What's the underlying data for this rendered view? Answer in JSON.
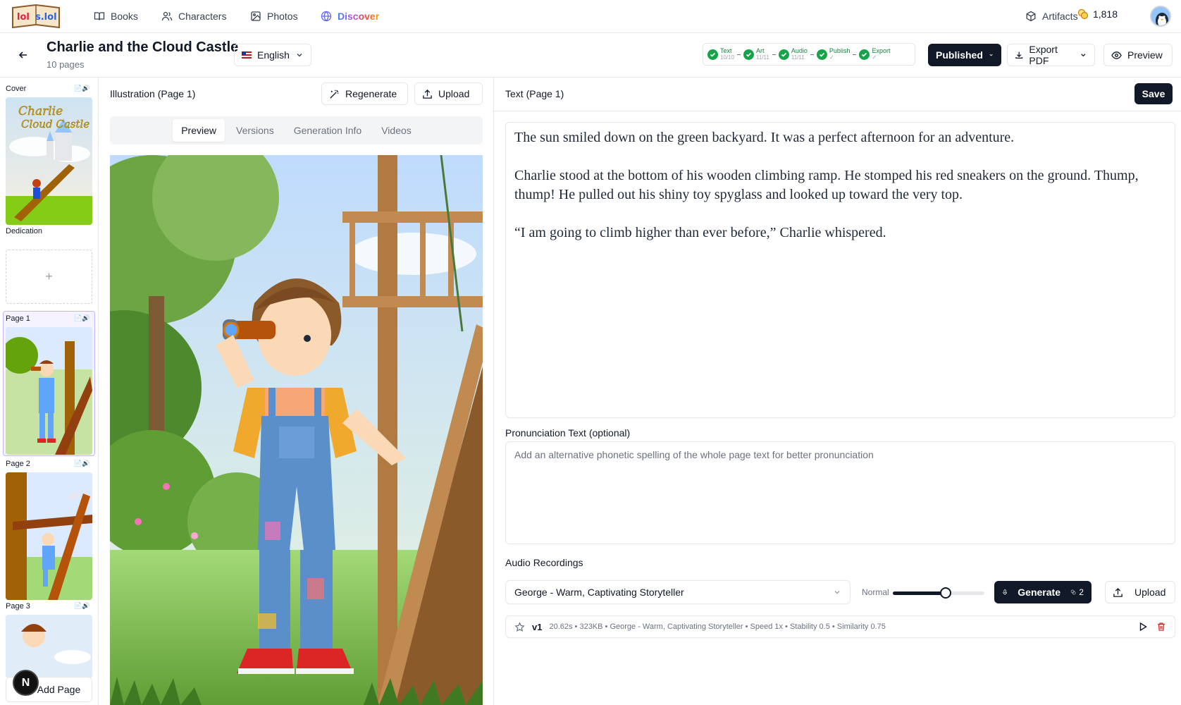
{
  "nav": {
    "logo_text": "lol's.lol",
    "items": [
      {
        "label": "Books",
        "icon": "book-icon"
      },
      {
        "label": "Characters",
        "icon": "users-icon"
      },
      {
        "label": "Photos",
        "icon": "image-icon"
      },
      {
        "label": "Discover",
        "icon": "globe-icon"
      }
    ],
    "artifacts_label": "Artifacts",
    "credits": "1,818"
  },
  "header": {
    "title": "Charlie and the Cloud Castle",
    "subtitle": "10 pages",
    "language": "English",
    "progress": [
      {
        "name": "Text",
        "count": "10/10"
      },
      {
        "name": "Art",
        "count": "11/11"
      },
      {
        "name": "Audio",
        "count": "11/11"
      },
      {
        "name": "Publish",
        "count": "✓"
      },
      {
        "name": "Export",
        "count": "✓"
      }
    ],
    "status_label": "Published",
    "export_label": "Export PDF",
    "preview_label": "Preview"
  },
  "sidebar": {
    "items": [
      {
        "label": "Cover",
        "icons": "📄🔊"
      },
      {
        "label": "Dedication"
      },
      {
        "label": "Page 1",
        "icons": "📄🔊"
      },
      {
        "label": "Page 2",
        "icons": "📄🔊"
      },
      {
        "label": "Page 3",
        "icons": "📄🔊"
      }
    ],
    "dedication_add": "+",
    "add_page_label": "Add Page",
    "badge": "N"
  },
  "illustration": {
    "title": "Illustration (Page 1)",
    "regenerate_label": "Regenerate",
    "upload_label": "Upload",
    "tabs": [
      "Preview",
      "Versions",
      "Generation Info",
      "Videos"
    ],
    "active_tab": "Preview"
  },
  "text_panel": {
    "title": "Text (Page 1)",
    "save_label": "Save",
    "paragraphs": [
      "The sun smiled down on the green backyard. It was a perfect afternoon for an adventure.",
      "Charlie stood at the bottom of his wooden climbing ramp. He stomped his red sneakers on the ground. Thump, thump! He pulled out his shiny toy spyglass and looked up toward the very top.",
      "“I am going to climb higher than ever before,” Charlie whispered."
    ],
    "pronunciation_label": "Pronunciation Text (optional)",
    "pronunciation_placeholder": "Add an alternative phonetic spelling of the whole page text for better pronunciation"
  },
  "audio": {
    "label": "Audio Recordings",
    "voice": "George - Warm, Captivating Storyteller",
    "speed_label": "Normal",
    "speed_level": 0.58,
    "generate_label": "Generate",
    "generate_count": "2",
    "upload_label": "Upload",
    "recording": {
      "version": "v1",
      "meta": "20.62s • 323KB • George - Warm, Captivating Storyteller • Speed 1x • Stability 0.5 • Similarity 0.75"
    }
  },
  "colors": {
    "accent_dark": "#111827",
    "success": "#16a34a",
    "danger": "#dc2626",
    "selected_border": "#c4b5fd"
  }
}
